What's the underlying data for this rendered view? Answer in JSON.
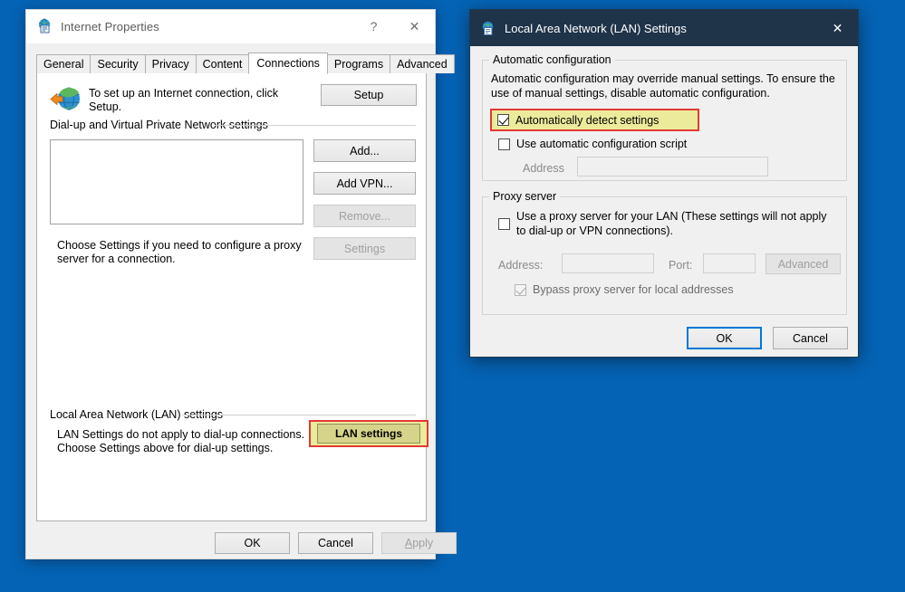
{
  "desktop": {
    "background_color": "#0563b5"
  },
  "internet_properties": {
    "title": "Internet Properties",
    "icon": "internet-properties-icon",
    "help_button": "?",
    "close_button": "✕",
    "tabs": [
      {
        "label": "General",
        "active": false
      },
      {
        "label": "Security",
        "active": false
      },
      {
        "label": "Privacy",
        "active": false
      },
      {
        "label": "Content",
        "active": false
      },
      {
        "label": "Connections",
        "active": true
      },
      {
        "label": "Programs",
        "active": false
      },
      {
        "label": "Advanced",
        "active": false
      }
    ],
    "setup_section": {
      "icon": "globe-with-arrow-icon",
      "text": "To set up an Internet connection, click Setup.",
      "button_label": "Setup"
    },
    "dialup_group": {
      "label": "Dial-up and Virtual Private Network settings",
      "list_items": [],
      "buttons": [
        {
          "label": "Add...",
          "enabled": true
        },
        {
          "label": "Add VPN...",
          "enabled": true
        },
        {
          "label": "Remove...",
          "enabled": false
        },
        {
          "label": "Settings",
          "enabled": false
        }
      ],
      "hint_text": "Choose Settings if you need to configure a proxy server for a connection."
    },
    "lan_group": {
      "label": "Local Area Network (LAN) settings",
      "description": "LAN Settings do not apply to dial-up connections. Choose Settings above for dial-up settings.",
      "button_label": "LAN settings",
      "highlight_border_color": "#e03a32",
      "highlight_fill_color": "#eceb9c"
    },
    "footer_buttons": [
      {
        "label": "OK",
        "enabled": true
      },
      {
        "label": "Cancel",
        "enabled": true
      },
      {
        "label": "Apply",
        "enabled": false,
        "accel": "A",
        "rest": "pply"
      }
    ]
  },
  "lan_settings": {
    "title": "Local Area Network (LAN) Settings",
    "icon": "lan-settings-icon",
    "close_button": "✕",
    "titlebar_color": "#1f3349",
    "automatic_configuration": {
      "group_label": "Automatic configuration",
      "description": "Automatic configuration may override manual settings.  To ensure the use of manual settings, disable automatic configuration.",
      "auto_detect": {
        "label": "Automatically detect settings",
        "checked": true,
        "highlighted": true,
        "highlight_border_color": "#e03a32",
        "highlight_fill_color": "#eceb9c"
      },
      "use_script": {
        "label": "Use automatic configuration script",
        "checked": false
      },
      "address_label": "Address",
      "address_value": "",
      "address_enabled": false
    },
    "proxy_server": {
      "group_label": "Proxy server",
      "use_proxy": {
        "label": "Use a proxy server for your LAN (These settings will not apply to dial-up or VPN connections).",
        "checked": false
      },
      "address_label": "Address:",
      "address_value": "",
      "port_label": "Port:",
      "port_value": "",
      "advanced_button": {
        "label": "Advanced",
        "enabled": false
      },
      "bypass": {
        "label": "Bypass proxy server for local addresses",
        "checked": true,
        "enabled": false
      }
    },
    "footer_buttons": [
      {
        "label": "OK",
        "enabled": true,
        "default": true
      },
      {
        "label": "Cancel",
        "enabled": true,
        "default": false
      }
    ]
  }
}
